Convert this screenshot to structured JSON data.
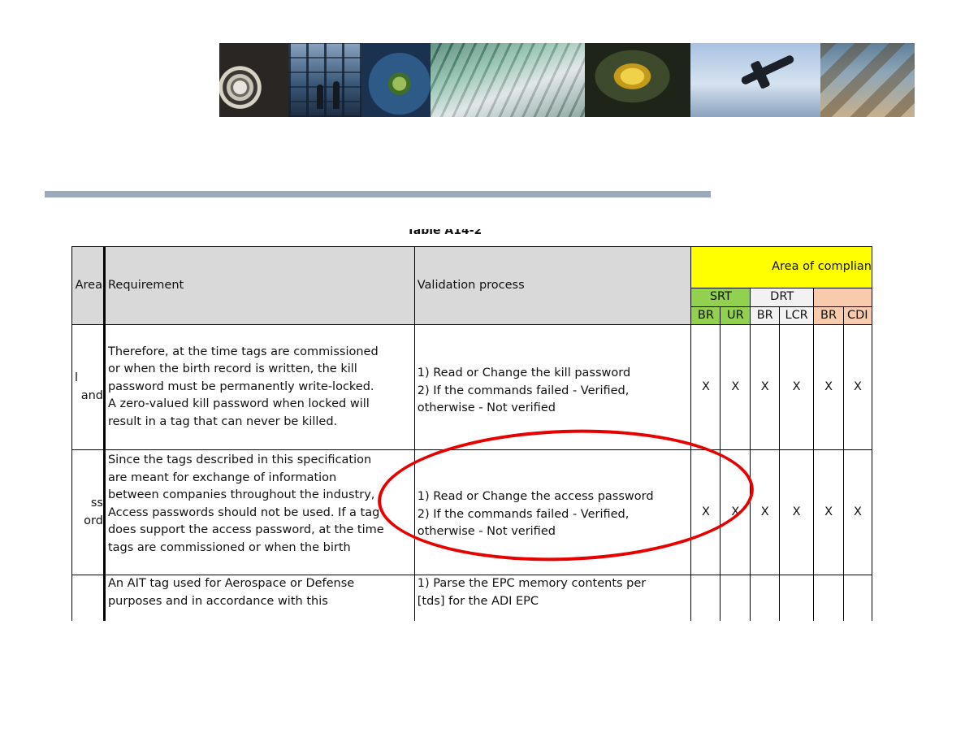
{
  "table": {
    "caption": "Table A14-2",
    "headers": {
      "area": "Area",
      "requirement": "Requirement",
      "validation": "Validation process",
      "compliance": "Area of complian",
      "srt": "SRT",
      "drt": "DRT",
      "sub": [
        "BR",
        "UR",
        "BR",
        "LCR",
        "BR",
        "CDI"
      ]
    },
    "rows": [
      {
        "area_lines": [
          "l",
          "and"
        ],
        "requirement_lines": [
          "Therefore, at the time tags are commissioned",
          "or when the birth record is written, the kill",
          "password must be permanently write-locked.",
          "A zero-valued kill password when locked will",
          "result in a tag that can never be killed."
        ],
        "validation_lines": [
          "1) Read or Change the kill password",
          "2) If the commands failed - Verified,",
          "otherwise - Not verified"
        ],
        "marks": [
          "X",
          "X",
          "X",
          "X",
          "X",
          "X"
        ]
      },
      {
        "area_lines": [
          "ss",
          "ord"
        ],
        "requirement_lines": [
          "Since the tags described in this specification",
          "are meant for exchange of information",
          "between companies throughout the industry,",
          "Access passwords should not be used. If a tag",
          "does support the access password, at the time",
          "tags are commissioned or when the birth"
        ],
        "validation_lines": [
          "1) Read or Change the access password",
          "2) If the commands failed - Verified,",
          "otherwise - Not verified"
        ],
        "marks": [
          "X",
          "X",
          "X",
          "X",
          "X",
          "X"
        ]
      },
      {
        "area_lines": [
          ""
        ],
        "requirement_lines": [
          "An AIT tag used for Aerospace or Defense",
          "purposes and in accordance with this"
        ],
        "validation_lines": [
          "1) Parse the EPC memory contents per",
          "[tds] for the ADI EPC"
        ],
        "marks": [
          "",
          "",
          "",
          "",
          "",
          ""
        ]
      }
    ]
  },
  "colors": {
    "divider": "#9aa9bb",
    "annotation": "#e60000",
    "compliance_header": "#ffff00",
    "srt_header": "#92d050"
  }
}
